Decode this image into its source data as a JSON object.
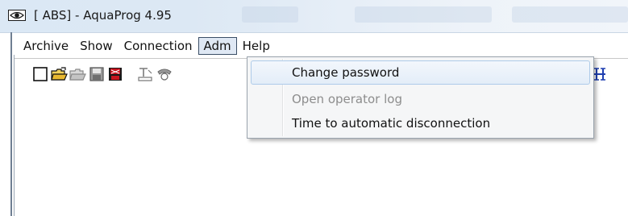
{
  "window": {
    "title": "[ ABS] - AquaProg 4.95",
    "title_icon": "eye-icon"
  },
  "menubar": {
    "items": [
      {
        "label": "Archive"
      },
      {
        "label": "Show"
      },
      {
        "label": "Connection"
      },
      {
        "label": "Adm",
        "active": true
      },
      {
        "label": "Help"
      }
    ]
  },
  "toolbar": {
    "buttons": [
      {
        "icon": "new-document-icon"
      },
      {
        "icon": "open-folder-icon"
      },
      {
        "icon": "open-folder-disabled-icon"
      },
      {
        "icon": "save-disk-icon"
      },
      {
        "icon": "save-disk-red-icon"
      },
      {
        "icon": "text-tool-icon"
      },
      {
        "icon": "telephone-icon"
      },
      {
        "icon": "vertical-arrows-icon"
      }
    ]
  },
  "adm_menu": {
    "items": [
      {
        "label": "Change password",
        "state": "highlighted"
      },
      {
        "label": "Open operator log",
        "state": "disabled"
      },
      {
        "label": "Time to automatic disconnection",
        "state": "enabled"
      }
    ]
  },
  "colors": {
    "menu_highlight_border": "#aecbe9",
    "disabled_text": "#8d8d8d",
    "toolbar_accent": "#1f3fb0",
    "save_red": "#c8141e"
  }
}
